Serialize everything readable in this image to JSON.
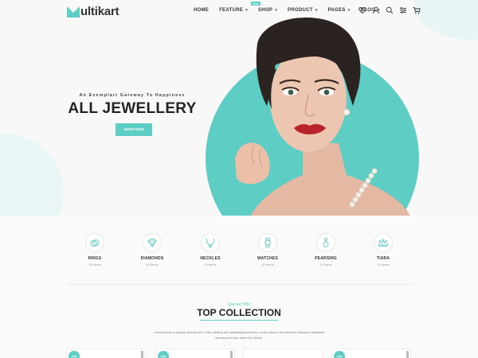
{
  "header": {
    "logo_text": "ultikart",
    "nav": [
      {
        "label": "HOME",
        "has_menu": false
      },
      {
        "label": "FEATURE",
        "has_menu": true,
        "badge": "new"
      },
      {
        "label": "SHOP",
        "has_menu": true
      },
      {
        "label": "PRODUCT",
        "has_menu": true
      },
      {
        "label": "PAGES",
        "has_menu": true
      },
      {
        "label": "BLOG",
        "has_menu": true
      }
    ],
    "icons": [
      "heart-icon",
      "user-icon",
      "search-icon",
      "settings-icon",
      "cart-icon"
    ]
  },
  "hero": {
    "tagline": "An Exemplart Gateway To Happiness",
    "headline": "ALL JEWELLERY",
    "button": "SHOP NOW"
  },
  "categories": [
    {
      "name": "RINGS",
      "count": "25 Items",
      "icon": "ring-icon"
    },
    {
      "name": "DIAMONDS",
      "count": "54 Items",
      "icon": "diamond-icon"
    },
    {
      "name": "NECKLES",
      "count": "13 Items",
      "icon": "necklace-icon"
    },
    {
      "name": "WATCHES",
      "count": "42 Items",
      "icon": "watch-icon"
    },
    {
      "name": "PEARSING",
      "count": "12 Items",
      "icon": "earring-icon"
    },
    {
      "name": "TIARA",
      "count": "10 Items",
      "icon": "tiara-icon"
    }
  ],
  "collection": {
    "eyebrow": "Special Offer",
    "title": "TOP COLLECTION",
    "description": "Lorem Ipsum is simply dummy text of the printing and typesetting industry. Lorem Ipsum has been the industry's standard dummy text ever since the 1500s."
  },
  "cards": [
    {
      "badge": "new"
    },
    {
      "badge": "new"
    },
    {
      "badge": ""
    },
    {
      "badge": "new"
    }
  ],
  "colors": {
    "accent": "#5ecdc4",
    "text": "#222222",
    "background": "#f8f8f8"
  }
}
